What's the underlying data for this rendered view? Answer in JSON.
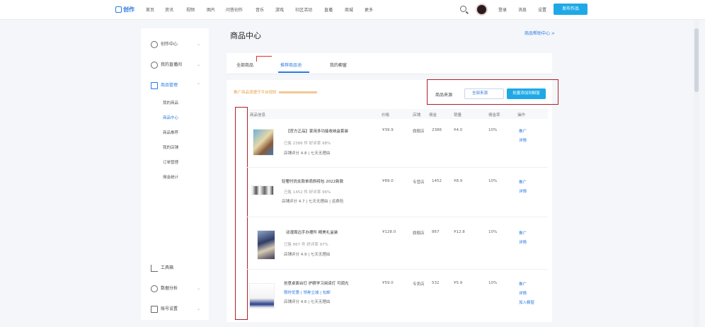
{
  "nav": {
    "logo": "创作",
    "items": [
      "首页",
      "资讯",
      "视频",
      "图片",
      "问答创作",
      "音乐",
      "游戏",
      "社区活动",
      "直播",
      "商城",
      "更多"
    ],
    "login": "登录",
    "register": "消息",
    "settings": "设置",
    "publish": "发布作品"
  },
  "sidebar": {
    "groups": [
      {
        "label": "创作中心"
      },
      {
        "label": "我的直播间"
      },
      {
        "label": "商品管理"
      },
      {
        "label": "工具箱"
      },
      {
        "label": "数据分析"
      },
      {
        "label": "账号设置"
      }
    ],
    "subitems": [
      "我的商品",
      "商品中心",
      "商品推荐",
      "我的店铺",
      "订单管理",
      "佣金统计"
    ]
  },
  "page": {
    "title": "商品中心",
    "help": "商品帮助中心 >"
  },
  "tabs": [
    "全部商品",
    "推荐商品池",
    "我的橱窗"
  ],
  "notice": "推广商品须遵守平台规则",
  "filter": {
    "label": "商品来源",
    "select": "全部来源",
    "action": "批量添加到橱窗"
  },
  "table": {
    "headers": [
      "商品信息",
      "价格",
      "店铺",
      "佣金",
      "销量",
      "佣金率",
      "操作"
    ],
    "rows": [
      {
        "title": "【官方正品】家用多功能收纳盒套装",
        "sub": "已售 2386 件 好评率 98%",
        "meta": "店铺评分 4.8 | 七天无理由",
        "price": "¥39.9",
        "shop": "旗舰店",
        "commission": "¥4.0",
        "sales": "2386",
        "rate": "10%",
        "ops": [
          "推广",
          "详情"
        ]
      },
      {
        "title": "轻奢时尚女款单肩斜挎包 2022新款",
        "sub": "已售 1452 件 好评率 96%",
        "meta": "店铺评分 4.7 | 七天无理由 | 运费险",
        "price": "¥89.0",
        "shop": "专营店",
        "commission": "¥8.9",
        "sales": "1452",
        "rate": "10%",
        "ops": [
          "推广",
          "详情"
        ]
      },
      {
        "title": "动漫周边手办摆件 精美礼盒装",
        "sub": "已售 867 件 好评率 97%",
        "meta": "店铺评分 4.9 | 七天无理由",
        "price": "¥128.0",
        "shop": "旗舰店",
        "commission": "¥12.8",
        "sales": "867",
        "rate": "10%",
        "ops": [
          "推广",
          "详情"
        ]
      },
      {
        "title": "创意桌面台灯 护眼学习阅读灯 可调光",
        "sub": "限时优惠 | 领券立减 | 包邮",
        "meta": "店铺评分 4.6 | 七天无理由",
        "price": "¥59.0",
        "shop": "专卖店",
        "commission": "¥5.9",
        "sales": "532",
        "rate": "10%",
        "ops": [
          "推广",
          "详情",
          "加入橱窗"
        ]
      }
    ]
  },
  "colors": {
    "accent": "#2a7ae2",
    "button": "#1ea9e6",
    "highlight": "#b0202a",
    "notice": "#e8a04a"
  }
}
